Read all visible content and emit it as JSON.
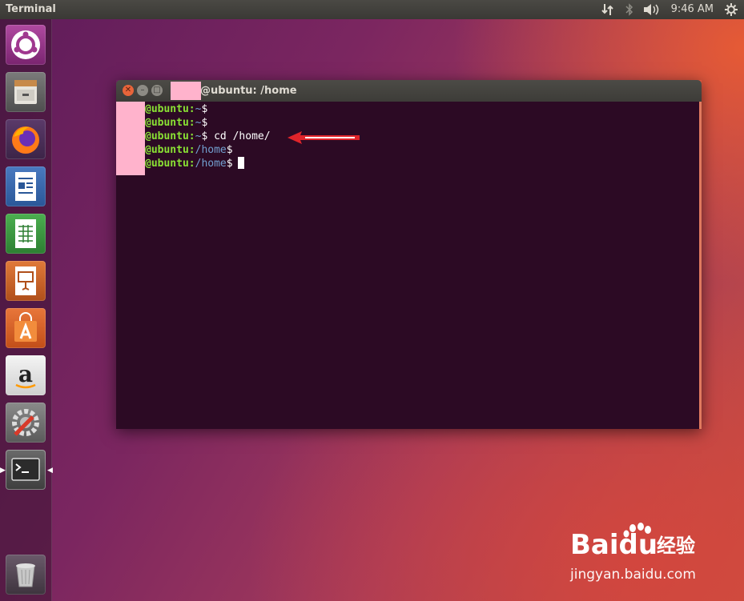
{
  "panel": {
    "title": "Terminal",
    "clock": "9:46 AM",
    "icons": [
      "network-icon",
      "bluetooth-icon",
      "volume-icon",
      "gear-icon"
    ]
  },
  "launcher": {
    "items": [
      "ubuntu-dash",
      "files",
      "firefox",
      "libreoffice-writer",
      "libreoffice-calc",
      "libreoffice-impress",
      "software-center",
      "amazon",
      "system-settings",
      "terminal",
      "trash"
    ]
  },
  "terminal": {
    "title": "@ubuntu: /home",
    "lines": [
      {
        "user": "@ubuntu",
        "sep": ":",
        "path": "~",
        "prompt": "$",
        "cmd": ""
      },
      {
        "user": "@ubuntu",
        "sep": ":",
        "path": "~",
        "prompt": "$",
        "cmd": ""
      },
      {
        "user": "@ubuntu",
        "sep": ":",
        "path": "~",
        "prompt": "$",
        "cmd": " cd /home/"
      },
      {
        "user": "@ubuntu",
        "sep": ":",
        "path": "/home",
        "prompt": "$",
        "cmd": ""
      },
      {
        "user": "@ubuntu",
        "sep": ":",
        "path": "/home",
        "prompt": "$",
        "cmd": ""
      }
    ]
  },
  "watermark": {
    "brand": "Baidu",
    "brand_cn": "经验",
    "url": "jingyan.baidu.com"
  },
  "colors": {
    "terminal_bg": "#2c0a24",
    "user_green": "#8ae234",
    "path_blue": "#729fcf",
    "annotation_red": "#e0242a"
  }
}
